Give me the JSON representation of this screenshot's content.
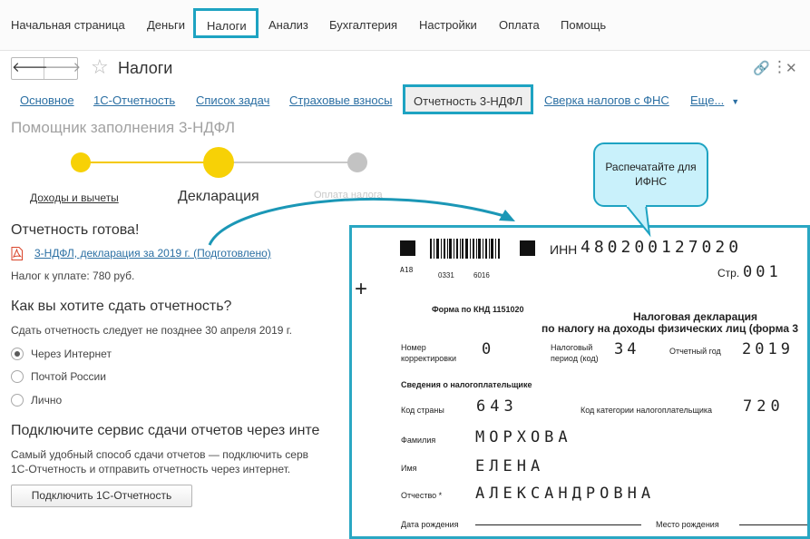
{
  "top_menu": {
    "items": [
      {
        "label": "Начальная страница"
      },
      {
        "label": "Деньги"
      },
      {
        "label": "Налоги"
      },
      {
        "label": "Анализ"
      },
      {
        "label": "Бухгалтерия"
      },
      {
        "label": "Настройки"
      },
      {
        "label": "Оплата"
      },
      {
        "label": "Помощь"
      }
    ],
    "active": "Налоги"
  },
  "window": {
    "back_glyph": "🡐",
    "forward_glyph": "🡒",
    "favorite_glyph": "☆",
    "title": "Налоги",
    "link_glyph": "🔗",
    "more_glyph": "⋮",
    "close_glyph": "✕",
    "icons": [
      "arrow-left-icon",
      "arrow-right-icon",
      "star-icon",
      "link-icon",
      "more-icon",
      "close-icon"
    ]
  },
  "tabs": {
    "items": [
      {
        "label": "Основное"
      },
      {
        "label": "1С-Отчетность"
      },
      {
        "label": "Список задач"
      },
      {
        "label": "Страховые взносы"
      },
      {
        "label": "Отчетность 3-НДФЛ"
      },
      {
        "label": "Сверка налогов с ФНС"
      },
      {
        "label": "Еще..."
      }
    ],
    "active": "Отчетность 3-НДФЛ",
    "more_caret": "▼"
  },
  "wizard": {
    "title": "Помощник заполнения 3-НДФЛ",
    "steps": [
      {
        "label": "Доходы и вычеты",
        "state": "done"
      },
      {
        "label": "Декларация",
        "state": "current"
      },
      {
        "label": "Оплата налога",
        "state": "todo"
      }
    ]
  },
  "report": {
    "heading": "Отчетность готова!",
    "file_link": "3-НДФЛ, декларация за 2019 г. (Подготовлено)",
    "file_icon": "pdf-icon",
    "tax_due": "Налог к уплате: 780 руб."
  },
  "submission": {
    "heading": "Как вы хотите сдать отчетность?",
    "deadline": "Сдать отчетность следует не позднее 30 апреля 2019 г.",
    "options": [
      {
        "label": "Через Интернет",
        "checked": true
      },
      {
        "label": "Почтой России",
        "checked": false
      },
      {
        "label": "Лично",
        "checked": false
      }
    ]
  },
  "service": {
    "heading": "Подключите сервис сдачи отчетов через инте",
    "desc_line1": "Самый удобный способ сдачи отчетов — подключить серв",
    "desc_line2": "1С-Отчетность и отправить отчетность через интернет.",
    "button": "Подключить 1С-Отчетность"
  },
  "callout": {
    "line1": "Распечатайте для",
    "line2": "ИФНС"
  },
  "declaration": {
    "barcode_numbers": [
      "A18",
      "0331",
      "6016"
    ],
    "inn_label": "ИНН",
    "inn": "480200127020",
    "page_label": "Стр.",
    "page": "001",
    "plus": "+",
    "form_code": "Форма по КНД 1151020",
    "title_line1": "Налоговая декларация",
    "title_line2": "по налогу на доходы физических лиц (форма 3",
    "correction_label_1": "Номер",
    "correction_label_2": "корректировки",
    "correction": "0",
    "period_label_1": "Налоговый",
    "period_label_2": "период (код)",
    "period": "34",
    "year_label": "Отчетный год",
    "year": "2019",
    "taxpayer_heading": "Сведения о налогоплательщике",
    "country_label": "Код страны",
    "country": "643",
    "category_label": "Код категории налогоплательщика",
    "category": "720",
    "surname_label": "Фамилия",
    "surname": "МОРХОВА",
    "name_label": "Имя",
    "name": "ЕЛЕНА",
    "patronymic_label": "Отчество *",
    "patronymic": "АЛЕКСАНДРОВНА",
    "birth_date_label": "Дата рождения",
    "birth_place_label": "Место рождения"
  },
  "colors": {
    "highlight": "#1ea3c2",
    "link": "#2b6fa3",
    "step_done": "#f7d106",
    "step_todo": "#c3c3c3",
    "callout_fill": "#c9f1fb"
  }
}
